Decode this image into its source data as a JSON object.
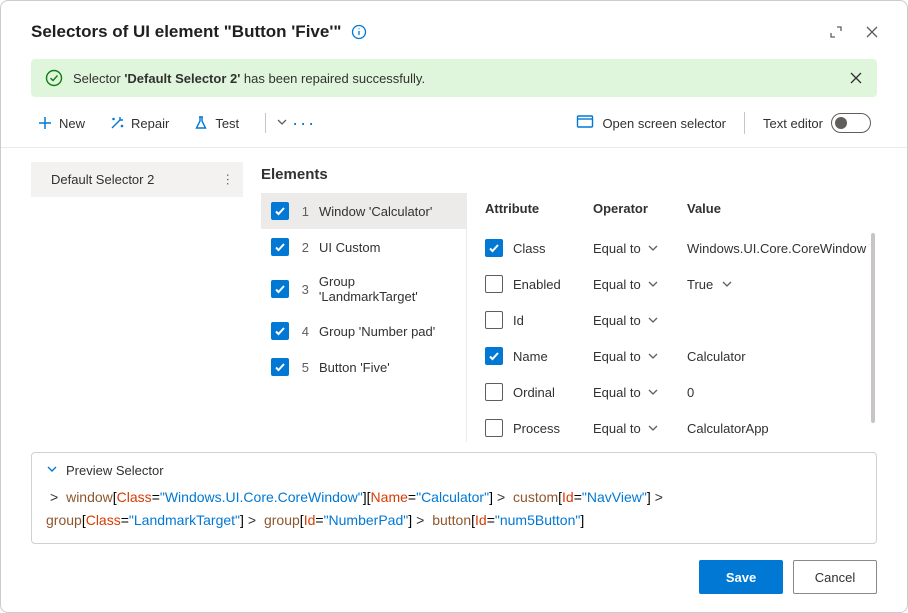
{
  "header": {
    "title": "Selectors of UI element \"Button 'Five'\""
  },
  "banner": {
    "prefix": "Selector ",
    "name": "'Default Selector 2'",
    "suffix": " has been repaired successfully."
  },
  "toolbar": {
    "new": "New",
    "repair": "Repair",
    "test": "Test",
    "open_screen": "Open screen selector",
    "text_editor": "Text editor"
  },
  "sidebar": {
    "items": [
      {
        "label": "Default Selector 2",
        "selected": true
      }
    ]
  },
  "elements": {
    "title": "Elements",
    "rows": [
      {
        "n": "1",
        "label": "Window 'Calculator'",
        "checked": true,
        "selected": true
      },
      {
        "n": "2",
        "label": "UI Custom",
        "checked": true,
        "selected": false
      },
      {
        "n": "3",
        "label": "Group 'LandmarkTarget'",
        "checked": true,
        "selected": false
      },
      {
        "n": "4",
        "label": "Group 'Number pad'",
        "checked": true,
        "selected": false
      },
      {
        "n": "5",
        "label": "Button 'Five'",
        "checked": true,
        "selected": false
      }
    ]
  },
  "attrs": {
    "header": {
      "a": "Attribute",
      "o": "Operator",
      "v": "Value"
    },
    "rows": [
      {
        "checked": true,
        "name": "Class",
        "op": "Equal to",
        "value": "Windows.UI.Core.CoreWindow",
        "value_chev": false
      },
      {
        "checked": false,
        "name": "Enabled",
        "op": "Equal to",
        "value": "True",
        "value_chev": true
      },
      {
        "checked": false,
        "name": "Id",
        "op": "Equal to",
        "value": "",
        "value_chev": false
      },
      {
        "checked": true,
        "name": "Name",
        "op": "Equal to",
        "value": "Calculator",
        "value_chev": false
      },
      {
        "checked": false,
        "name": "Ordinal",
        "op": "Equal to",
        "value": "0",
        "value_chev": false
      },
      {
        "checked": false,
        "name": "Process",
        "op": "Equal to",
        "value": "CalculatorApp",
        "value_chev": false
      }
    ]
  },
  "preview": {
    "label": "Preview Selector",
    "segments": [
      {
        "type": "gt"
      },
      {
        "text": "window",
        "color": "#8e562e"
      },
      {
        "text": "[",
        "color": "#000"
      },
      {
        "text": "Class",
        "color": "#d83b01"
      },
      {
        "text": "=",
        "color": "#000"
      },
      {
        "text": "\"Windows.UI.Core.CoreWindow\"",
        "color": "#0078d4"
      },
      {
        "text": "][",
        "color": "#000"
      },
      {
        "text": "Name",
        "color": "#d83b01"
      },
      {
        "text": "=",
        "color": "#000"
      },
      {
        "text": "\"Calculator\"",
        "color": "#0078d4"
      },
      {
        "text": "]",
        "color": "#000"
      },
      {
        "type": "gt"
      },
      {
        "text": "custom",
        "color": "#8e562e"
      },
      {
        "text": "[",
        "color": "#000"
      },
      {
        "text": "Id",
        "color": "#d83b01"
      },
      {
        "text": "=",
        "color": "#000"
      },
      {
        "text": "\"NavView\"",
        "color": "#0078d4"
      },
      {
        "text": "]",
        "color": "#000"
      },
      {
        "type": "gt"
      },
      {
        "text": "group",
        "color": "#8e562e"
      },
      {
        "text": "[",
        "color": "#000"
      },
      {
        "text": "Class",
        "color": "#d83b01"
      },
      {
        "text": "=",
        "color": "#000"
      },
      {
        "text": "\"LandmarkTarget\"",
        "color": "#0078d4"
      },
      {
        "text": "]",
        "color": "#000"
      },
      {
        "type": "gt"
      },
      {
        "text": "group",
        "color": "#8e562e"
      },
      {
        "text": "[",
        "color": "#000"
      },
      {
        "text": "Id",
        "color": "#d83b01"
      },
      {
        "text": "=",
        "color": "#000"
      },
      {
        "text": "\"NumberPad\"",
        "color": "#0078d4"
      },
      {
        "text": "]",
        "color": "#000"
      },
      {
        "type": "gt"
      },
      {
        "text": "button",
        "color": "#8e562e"
      },
      {
        "text": "[",
        "color": "#000"
      },
      {
        "text": "Id",
        "color": "#d83b01"
      },
      {
        "text": "=",
        "color": "#000"
      },
      {
        "text": "\"num5Button\"",
        "color": "#0078d4"
      },
      {
        "text": "]",
        "color": "#000"
      }
    ]
  },
  "footer": {
    "save": "Save",
    "cancel": "Cancel"
  }
}
